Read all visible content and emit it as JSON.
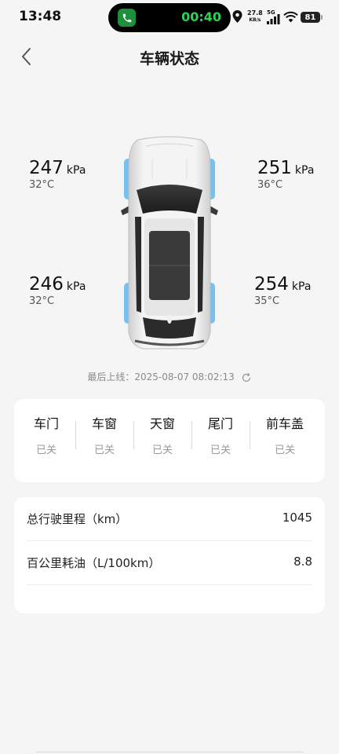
{
  "status_bar": {
    "time": "13:48",
    "call_timer": "00:40",
    "net_speed_value": "27.8",
    "net_speed_unit": "KB/s",
    "network_type": "5G",
    "battery": "81"
  },
  "header": {
    "title": "车辆状态",
    "back_icon": "chevron-left-icon"
  },
  "tires": {
    "front_left": {
      "pressure": "247",
      "unit": "kPa",
      "temp": "32°C"
    },
    "front_right": {
      "pressure": "251",
      "unit": "kPa",
      "temp": "36°C"
    },
    "rear_left": {
      "pressure": "246",
      "unit": "kPa",
      "temp": "32°C"
    },
    "rear_right": {
      "pressure": "254",
      "unit": "kPa",
      "temp": "35°C"
    }
  },
  "last_online": "最后上线：2025-08-07 08:02:13",
  "status_items": [
    {
      "label": "车门",
      "value": "已关"
    },
    {
      "label": "车窗",
      "value": "已关"
    },
    {
      "label": "天窗",
      "value": "已关"
    },
    {
      "label": "尾门",
      "value": "已关"
    },
    {
      "label": "前车盖",
      "value": "已关"
    }
  ],
  "info": {
    "mileage_label": "总行驶里程（km）",
    "mileage_value": "1045",
    "fuel_label": "百公里耗油（L/100km）",
    "fuel_value": "8.8"
  },
  "colors": {
    "tire_highlight": "#5fb7f0",
    "call_green": "#2fd158",
    "background": "#f5f5f5"
  }
}
